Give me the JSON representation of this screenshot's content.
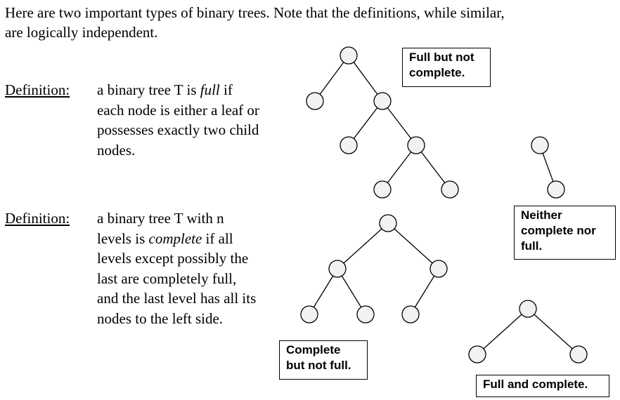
{
  "intro": {
    "line1": "Here are two important types of binary trees.  Note that the definitions, while similar,",
    "line2": "are logically independent."
  },
  "definitions": [
    {
      "term": "Definition:",
      "lines": [
        {
          "pre": "a binary tree T is ",
          "em": "full",
          "post": " if"
        },
        {
          "pre": "each node is either a leaf or",
          "em": "",
          "post": ""
        },
        {
          "pre": "possesses exactly two child",
          "em": "",
          "post": ""
        },
        {
          "pre": "nodes.",
          "em": "",
          "post": ""
        }
      ]
    },
    {
      "term": "Definition:",
      "lines": [
        {
          "pre": "a binary tree T with n",
          "em": "",
          "post": ""
        },
        {
          "pre": "levels is ",
          "em": "complete",
          "post": " if all"
        },
        {
          "pre": "levels except possibly the",
          "em": "",
          "post": ""
        },
        {
          "pre": "last are completely full,",
          "em": "",
          "post": ""
        },
        {
          "pre": "and the last level has all its",
          "em": "",
          "post": ""
        },
        {
          "pre": "nodes to the left side.",
          "em": "",
          "post": ""
        }
      ]
    }
  ],
  "labels": {
    "full_not_complete": [
      "Full but not",
      "complete."
    ],
    "neither": [
      "Neither",
      "complete nor",
      "full."
    ],
    "complete_not_full": [
      "Complete",
      "but not full."
    ],
    "full_and_complete": [
      "Full and complete."
    ]
  }
}
